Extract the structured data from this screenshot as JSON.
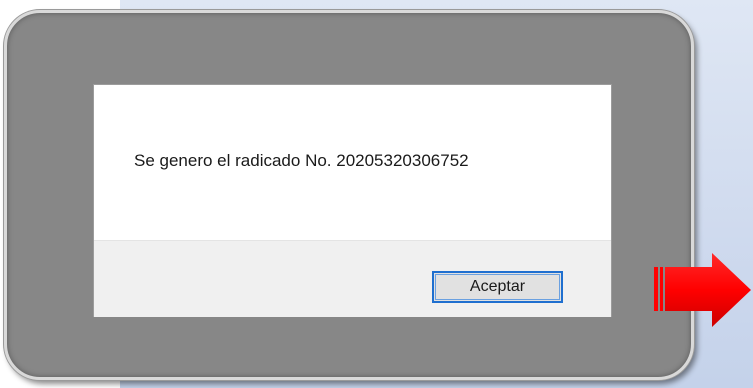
{
  "dialog": {
    "message": "Se genero el radicado No. 20205320306752",
    "accept_label": "Aceptar"
  },
  "annotation": {
    "arrow_icon": "right-arrow-icon",
    "arrow_color": "#ff0000"
  },
  "colors": {
    "frame": "#878787",
    "background": "#cfdaee",
    "button_border": "#1f6fcf"
  }
}
